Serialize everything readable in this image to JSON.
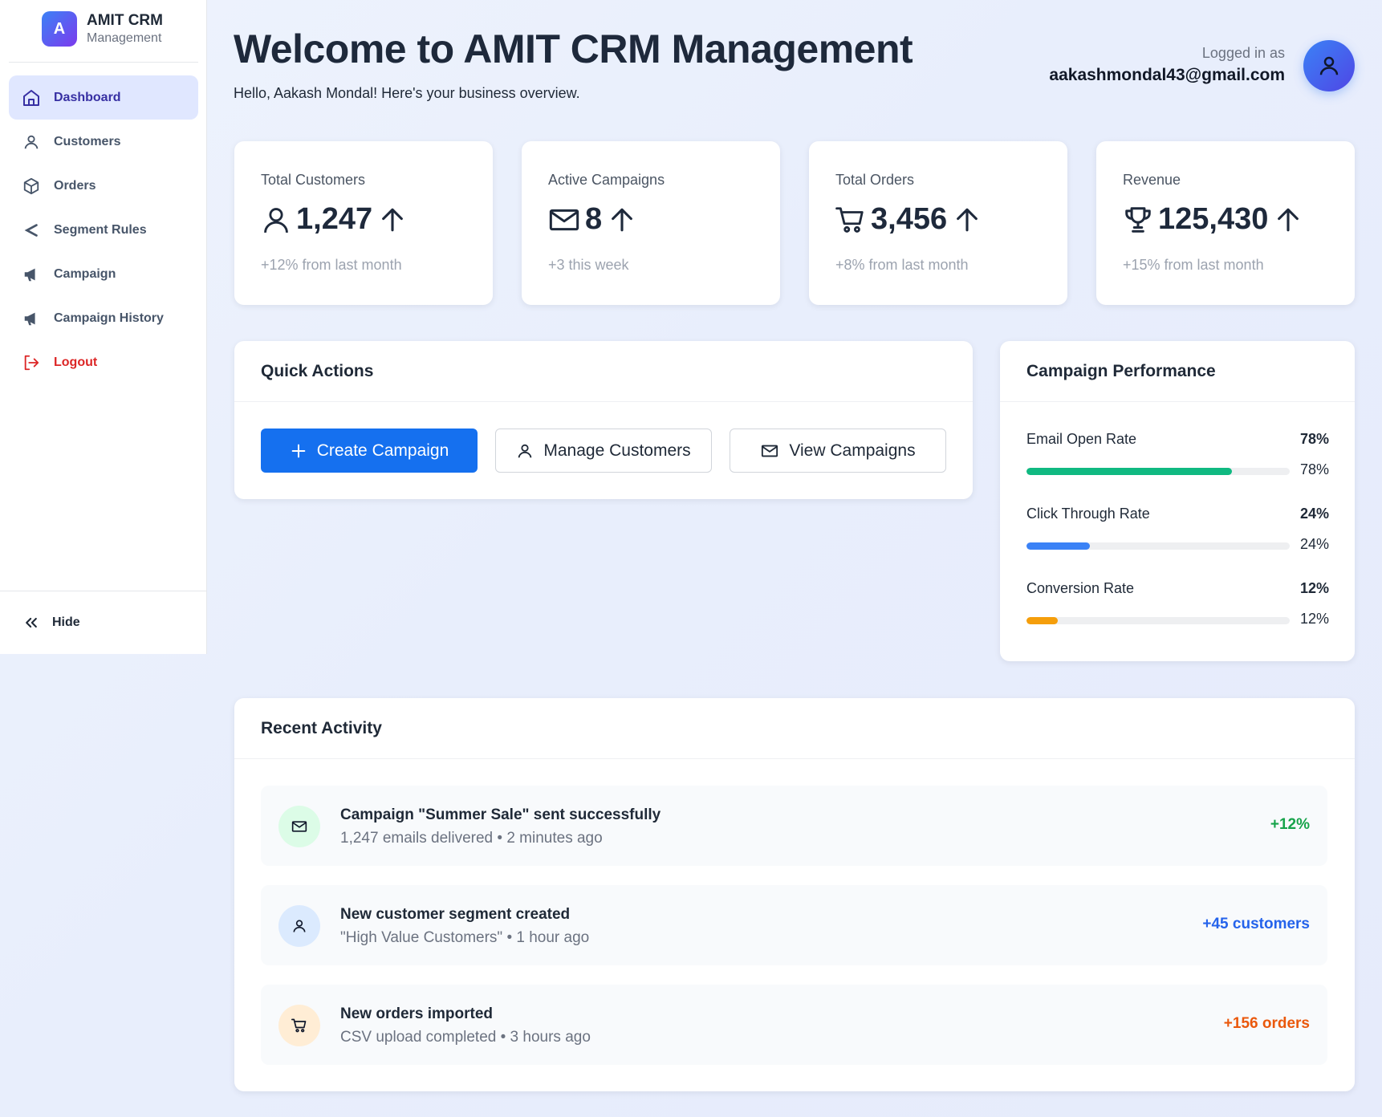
{
  "brand": {
    "logo_letter": "A",
    "title": "AMIT CRM",
    "subtitle": "Management"
  },
  "sidebar": {
    "items": [
      {
        "label": "Dashboard",
        "icon": "home-icon",
        "active": true
      },
      {
        "label": "Customers",
        "icon": "user-icon"
      },
      {
        "label": "Orders",
        "icon": "box-icon"
      },
      {
        "label": "Segment Rules",
        "icon": "chevron-left-icon"
      },
      {
        "label": "Campaign",
        "icon": "megaphone-icon"
      },
      {
        "label": "Campaign History",
        "icon": "megaphone-icon"
      },
      {
        "label": "Logout",
        "icon": "logout-icon"
      }
    ],
    "hide_label": "Hide"
  },
  "header": {
    "title": "Welcome to AMIT CRM Management",
    "subtitle": "Hello, Aakash Mondal! Here's your business overview.",
    "user_label": "Logged in as",
    "user_email": "aakashmondal43@gmail.com"
  },
  "stats": [
    {
      "label": "Total Customers",
      "value": "1,247",
      "note": "+12% from last month",
      "icon": "user-icon"
    },
    {
      "label": "Active Campaigns",
      "value": "8",
      "note": "+3 this week",
      "icon": "mail-icon"
    },
    {
      "label": "Total Orders",
      "value": "3,456",
      "note": "+8% from last month",
      "icon": "cart-icon"
    },
    {
      "label": "Revenue",
      "value": "125,430",
      "note": "+15% from last month",
      "icon": "trophy-icon"
    }
  ],
  "quick_actions": {
    "title": "Quick Actions",
    "buttons": [
      "Create Campaign",
      "Manage Customers",
      "View Campaigns"
    ]
  },
  "performance": {
    "title": "Campaign Performance",
    "metrics": [
      {
        "label": "Email Open Rate",
        "value": "78%",
        "fraction": 0.78,
        "color": "#10b981"
      },
      {
        "label": "Click Through Rate",
        "value": "24%",
        "fraction": 0.24,
        "color": "#3b82f6"
      },
      {
        "label": "Conversion Rate",
        "value": "12%",
        "fraction": 0.12,
        "color": "#f59e0b"
      }
    ]
  },
  "activity": {
    "title": "Recent Activity",
    "items": [
      {
        "title": "Campaign \"Summer Sale\" sent successfully",
        "subtitle": "1,247 emails delivered • 2 minutes ago",
        "badge": "+12%",
        "badge_color": "#16a34a",
        "icon": "mail-icon",
        "icon_bg": "#dcfce7"
      },
      {
        "title": "New customer segment created",
        "subtitle": "\"High Value Customers\" • 1 hour ago",
        "badge": "+45 customers",
        "badge_color": "#2563eb",
        "icon": "user-icon",
        "icon_bg": "#dbeafe"
      },
      {
        "title": "New orders imported",
        "subtitle": "CSV upload completed • 3 hours ago",
        "badge": "+156 orders",
        "badge_color": "#ea580c",
        "icon": "cart-icon",
        "icon_bg": "#ffedd5"
      }
    ]
  }
}
